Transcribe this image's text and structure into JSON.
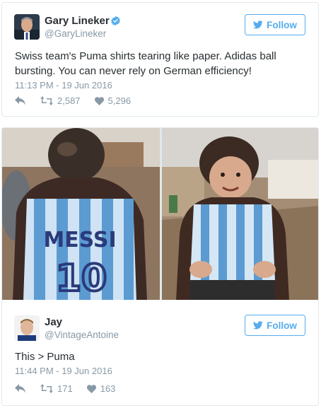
{
  "tweet": {
    "author_name": "Gary Lineker",
    "author_handle": "@GaryLineker",
    "verified_icon": "verified-badge-icon",
    "follow_label": "Follow",
    "text": "Swiss team's Puma shirts tearing like paper. Adidas ball bursting. You can never rely on German efficiency!",
    "timestamp": "11:13 PM - 19 Jun 2016",
    "retweets": "2,587",
    "likes": "5,296"
  },
  "reply": {
    "author_name": "Jay",
    "author_handle": "@VintageAntoine",
    "follow_label": "Follow",
    "text": "This > Puma",
    "timestamp": "11:44 PM - 19 Jun 2016",
    "retweets": "171",
    "likes": "163"
  },
  "photos": {
    "left_shirt_name": "MESSI",
    "left_shirt_number": "10"
  },
  "colors": {
    "twitter_blue": "#55acee",
    "muted_text": "#8899a6",
    "body_text": "#292f33",
    "border": "#e1e8ed"
  }
}
